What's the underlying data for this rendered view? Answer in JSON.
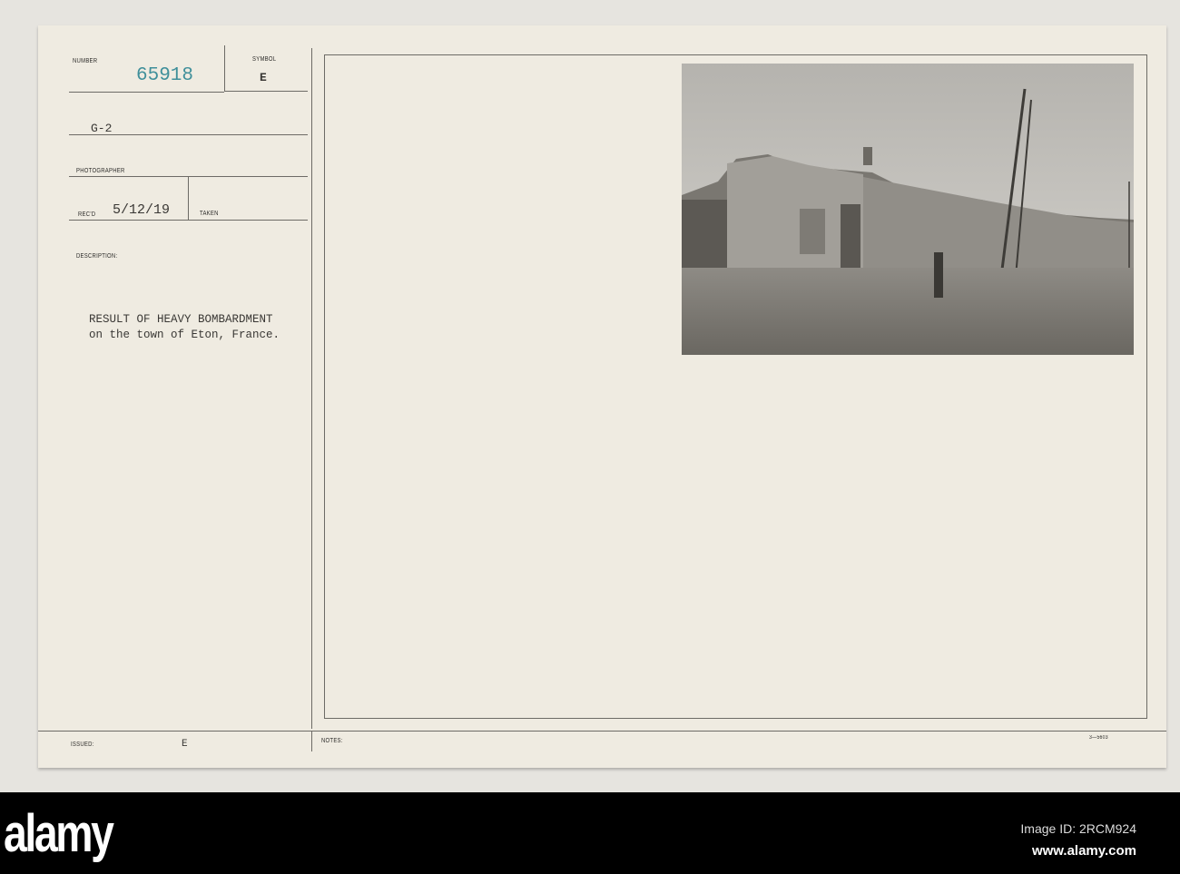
{
  "card": {
    "number_label": "NUMBER",
    "number": "65918",
    "symbol_label": "SYMBOL",
    "symbol": "E",
    "source": "G-2",
    "photographer_label": "PHOTOGRAPHER",
    "recd_label": "REC'D",
    "recd_date": "5/12/19",
    "taken_label": "TAKEN",
    "description_label": "DESCRIPTION:",
    "description_line1": "RESULT OF HEAVY BOMBARDMENT",
    "description_line2": "on the town of Eton, France.",
    "issued_label": "ISSUED:",
    "issued_mark": "E",
    "notes_label": "NOTES:",
    "form_number": "3—5603"
  },
  "colors": {
    "number_ink": "#3f8f9a",
    "paper": "#efebe1"
  },
  "footer": {
    "logo": "alamy",
    "image_id": "Image ID: 2RCM924",
    "url": "www.alamy.com"
  }
}
